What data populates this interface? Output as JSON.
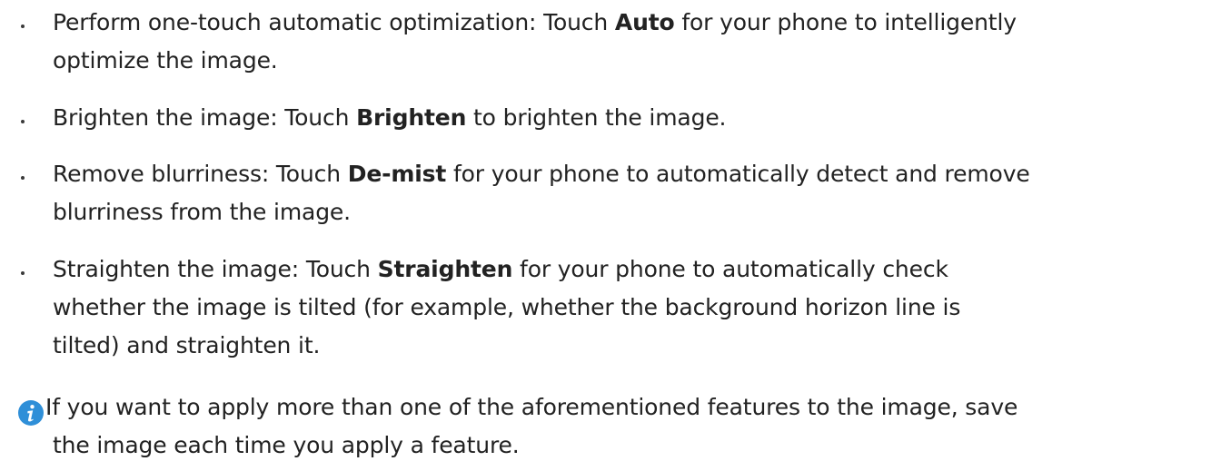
{
  "items": [
    {
      "line1_pre": "Perform one-touch automatic optimization: Touch ",
      "line1_bold": "Auto",
      "line1_post": " for your phone to intelligently",
      "line2": "optimize the image."
    },
    {
      "line1_pre": "Brighten the image: Touch ",
      "line1_bold": "Brighten",
      "line1_post": " to brighten the image."
    },
    {
      "line1_pre": "Remove blurriness: Touch ",
      "line1_bold": "De-mist",
      "line1_post": " for your phone to automatically detect and remove",
      "line2": "blurriness from the image."
    },
    {
      "line1_pre": "Straighten the image: Touch ",
      "line1_bold": "Straighten",
      "line1_post": " for your phone to automatically check",
      "line2": "whether the image is tilted (for example, whether the background horizon line is",
      "line3": "tilted) and straighten it."
    }
  ],
  "note": {
    "icon": "info-icon",
    "line1": "If you want to apply more than one of the aforementioned features to the image, save",
    "line2": "the image each time you apply a feature."
  },
  "colors": {
    "text": "#222222",
    "accent": "#2f8fd8"
  }
}
